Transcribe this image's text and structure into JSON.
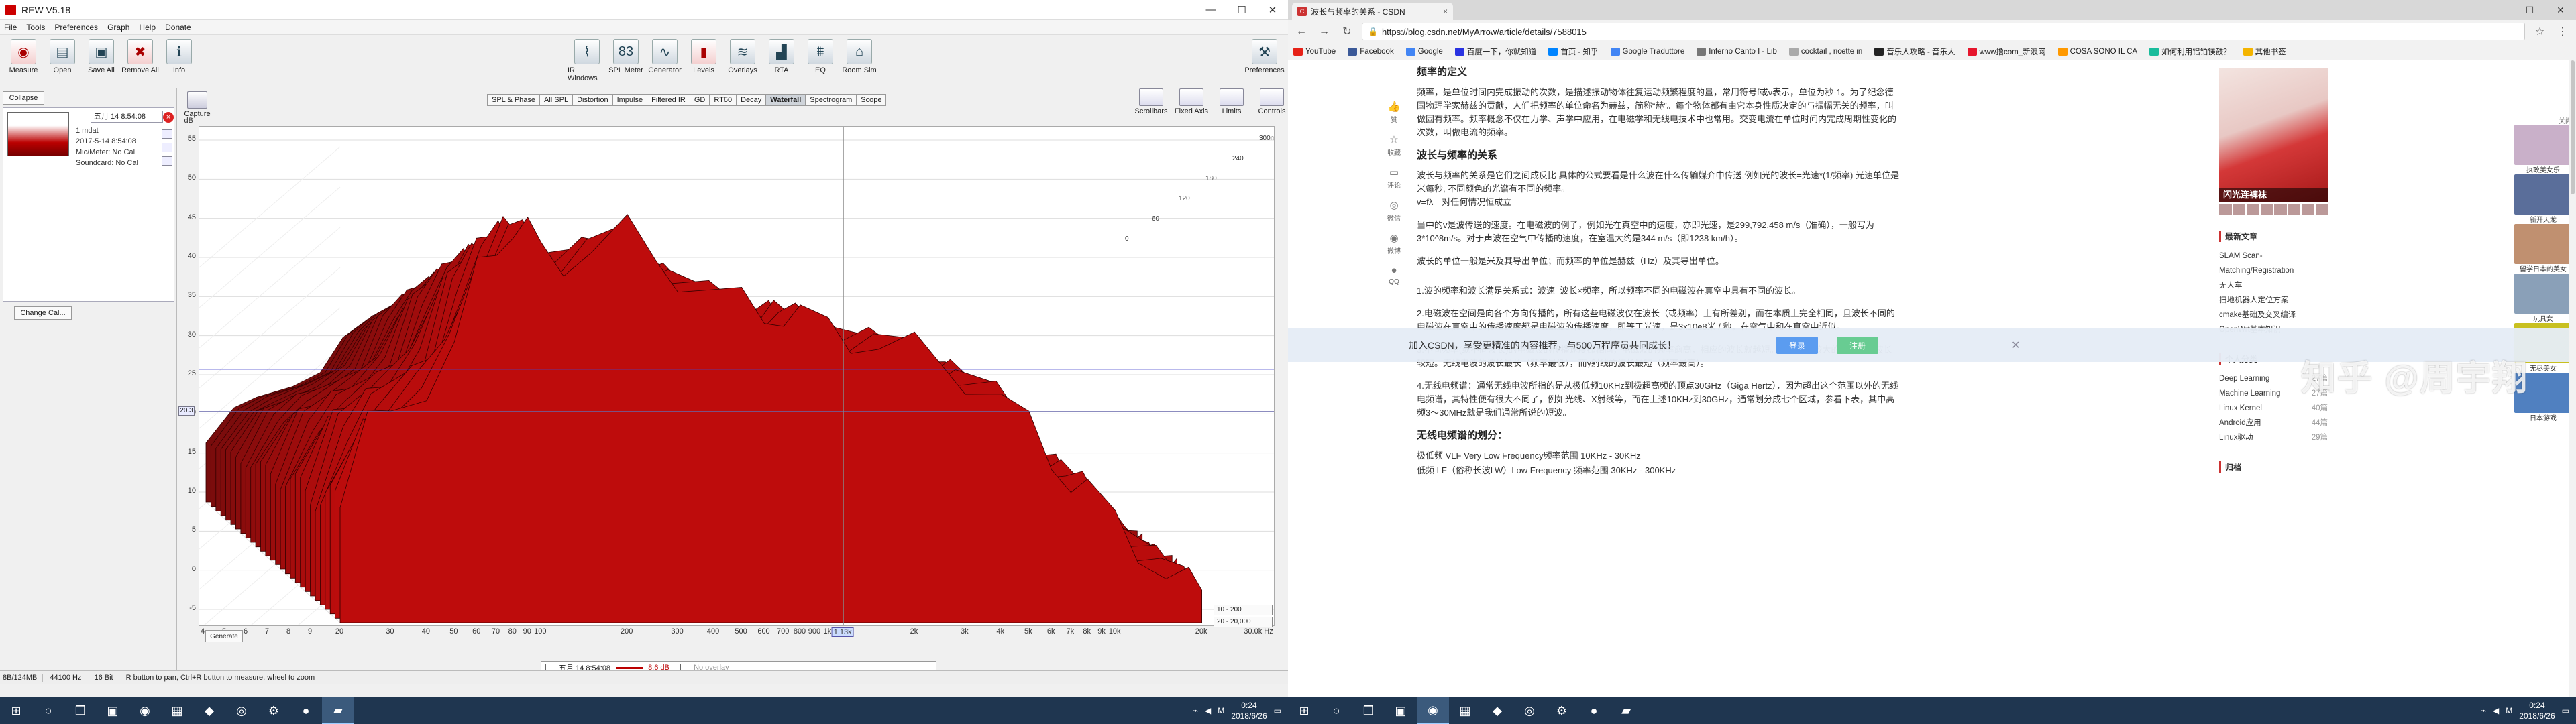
{
  "rew": {
    "title": "REW V5.18",
    "menu": [
      "File",
      "Tools",
      "Preferences",
      "Graph",
      "Help",
      "Donate"
    ],
    "toolbar_left": [
      {
        "label": "Measure",
        "icon": "measure-icon"
      },
      {
        "label": "Open",
        "icon": "folder-open-icon"
      },
      {
        "label": "Save All",
        "icon": "save-icon"
      },
      {
        "label": "Remove All",
        "icon": "remove-icon"
      },
      {
        "label": "Info",
        "icon": "info-icon"
      }
    ],
    "toolbar_right": [
      {
        "label": "IR Windows",
        "icon": "ir-windows-icon"
      },
      {
        "label": "SPL Meter",
        "icon": "spl-meter-icon",
        "badge": "83"
      },
      {
        "label": "Generator",
        "icon": "generator-icon"
      },
      {
        "label": "Levels",
        "icon": "levels-icon"
      },
      {
        "label": "Overlays",
        "icon": "overlays-icon"
      },
      {
        "label": "RTA",
        "icon": "rta-icon"
      },
      {
        "label": "EQ",
        "icon": "eq-icon"
      },
      {
        "label": "Room Sim",
        "icon": "room-sim-icon"
      }
    ],
    "preferences_label": "Preferences",
    "collapse_label": "Collapse",
    "measurement": {
      "name": "五月 14 8:54:08",
      "info": [
        "1 mdat",
        "2017-5-14 8:54:08",
        "Mic/Meter: No Cal",
        "Soundcard: No Cal"
      ]
    },
    "change_cal_label": "Change Cal...",
    "capture_label": "Capture",
    "graph_tabs": [
      "SPL & Phase",
      "All SPL",
      "Distortion",
      "Impulse",
      "Filtered IR",
      "GD",
      "RT60",
      "Decay",
      "Waterfall",
      "Spectrogram",
      "Scope"
    ],
    "active_tab": "Waterfall",
    "graph_controls": [
      "Scrollbars",
      "Fixed Axis",
      "Limits",
      "Controls"
    ],
    "generate_label": "Generate",
    "scale_boxes": [
      "10 - 200",
      "20 - 20,000"
    ],
    "legend": {
      "name": "五月 14 8:54:08",
      "value": "8.6 dB",
      "overlay": "No overlay"
    },
    "status": [
      "8B/124MB",
      "44100 Hz",
      "16 Bit",
      "R button to pan, Ctrl+R button to measure, wheel to zoom"
    ]
  },
  "chart_data": {
    "type": "area",
    "title": "",
    "xlabel": "",
    "ylabel": "dB",
    "x_scale": "log",
    "xlim": [
      20,
      30000
    ],
    "ylim": [
      -5,
      55
    ],
    "y_ticks": [
      55,
      50,
      45,
      40,
      35,
      30,
      25,
      20,
      15,
      10,
      5,
      0,
      -5
    ],
    "y_marker": "20.3",
    "x_ticks": [
      "20",
      "30",
      "40",
      "50",
      "60",
      "70",
      "80",
      "90",
      "100",
      "200",
      "300",
      "400",
      "500",
      "600",
      "700",
      "800",
      "900",
      "1k",
      "1.13k",
      "2k",
      "3k",
      "4k",
      "5k",
      "6k",
      "7k",
      "8k",
      "9k",
      "10k",
      "20k",
      "30.0k Hz"
    ],
    "x_tick_left": [
      "4",
      "5",
      "6",
      "7",
      "8",
      "9"
    ],
    "time_labels": [
      "300ms",
      "240",
      "180",
      "120",
      "60",
      "0"
    ],
    "color": "#b50f0f",
    "horizontal_markers_db": [
      25.7,
      20.3
    ],
    "cursor_freq": 1130,
    "series": [
      {
        "x": [
          20,
          25,
          30,
          40,
          50,
          60,
          70,
          80,
          90,
          100,
          120,
          150,
          200,
          250,
          300,
          400,
          500,
          600,
          700,
          800,
          1000,
          1200,
          1500,
          2000,
          2500,
          3000,
          4000,
          5000,
          6000,
          7000,
          8000,
          10000,
          12000,
          15000,
          18000,
          20000
        ],
        "y": [
          8,
          18,
          21,
          24,
          28,
          38,
          42,
          44,
          43,
          41,
          40,
          41,
          43,
          40,
          38,
          35,
          34,
          33,
          33,
          32,
          31,
          30,
          29,
          28,
          26,
          25,
          22,
          18,
          14,
          12,
          10,
          6,
          3,
          0,
          -2,
          -3
        ]
      }
    ]
  },
  "taskbar": {
    "left_time": "0:24",
    "left_date": "2018/6/26",
    "right_time": "0:24",
    "right_date": "2018/6/26"
  },
  "chrome": {
    "tab_title": "波长与频率的关系 - CSDN",
    "url": "https://blog.csdn.net/MyArrow/article/details/7588015",
    "bookmarks": [
      "YouTube",
      "Facebook",
      "Google",
      "百度一下，你就知道",
      "首页 - 知乎",
      "Google Traduttore",
      "Inferno Canto I - Lib",
      "cocktail , ricette in",
      "音乐人攻略 - 音乐人",
      "www撸com_新浪网",
      "COSA SONO IL CA",
      "如何利用铝铂镁鼓？",
      "其他书签"
    ],
    "share": [
      "赞",
      "收藏",
      "评论",
      "微信",
      "微博",
      "QQ"
    ],
    "article": {
      "h_def": "频率的定义",
      "p_def": "频率，是单位时间内完成振动的次数，是描述振动物体往复运动频繁程度的量，常用符号f或ν表示，单位为秒-1。为了纪念德国物理学家赫兹的贡献，人们把频率的单位命名为赫兹，简称“赫”。每个物体都有由它本身性质决定的与振幅无关的频率，叫做固有频率。频率概念不仅在力学、声学中应用，在电磁学和无线电技术中也常用。交变电流在单位时间内完成周期性变化的次数，叫做电流的频率。",
      "h_rel": "波长与频率的关系",
      "p_rel1": "波长与频率的关系是它们之间成反比 具体的公式要看是什么波在什么传输媒介中传送,例如光的波长=光速*(1/频率) 光速单位是米每秒, 不同颜色的光谱有不同的频率。",
      "p_rel2": "v=fλ　对任何情况恒成立",
      "p_rel3": "当中的v是波传送的速度。在电磁波的例子，例如光在真空中的速度，亦即光速，是299,792,458 m/s（准确），一般写为3*10^8m/s。对于声波在空气中传播的速度，在室温大约是344 m/s（即1238 km/h）。",
      "p_rel4": "波长的单位一般是米及其导出单位；而频率的单位是赫兹（Hz）及其导出单位。",
      "p_n1": "1.波的频率和波长满足关系式：波速=波长×频率，所以频率不同的电磁波在真空中具有不同的波长。",
      "p_n2": "2.电磁波在空间是向各个方向传播的，所有这些电磁波仅在波长（或频率）上有所差别，而在本质上完全相同，且波长不同的电磁波在真空中的传播速度都是电磁波的传播速度，即等于光速，是3x10e8米 / 秒，在空气中和在真空中近似。",
      "p_n3": "3.不同频率(或不同波长)的电磁波的传播速度都相同，电磁波的频率愈高，相应的波长就越短。所以频率较大的电磁波，波长较短。无线电波的波长最长（频率最低），而γ射线的波长最短（频率最高）。",
      "p_n4": "4.无线电频谱：通常无线电波所指的是从极低频10KHz到极超高频的顶点30GHz（Giga Hertz），因为超出这个范围以外的无线电频谱，其特性便有很大不同了，例如光线、X射线等，而在上述10KHz到30GHz，通常划分成七个区域，参看下表，其中高频3～30MHz就是我们通常所说的短波。",
      "h_div": "无线电频谱的划分：",
      "p_vlf": "极低频 VLF Very Low Frequency频率范围 10KHz - 30KHz",
      "p_lf": "低频 LF（俗称长波LW）Low Frequency 频率范围 30KHz - 300KHz"
    },
    "sidebar": {
      "ad_caption": "闪光连裤袜",
      "recent_title": "最新文章",
      "recent": [
        "SLAM Scan-Matching/Registration",
        "无人车",
        "扫地机器人定位方案",
        "cmake基础及交叉编译",
        "OpenWrt基本知识"
      ],
      "cat_title": "个人分类",
      "cats": [
        {
          "name": "Deep Learning",
          "count": "27篇"
        },
        {
          "name": "Machine Learning",
          "count": "27篇"
        },
        {
          "name": "Linux Kernel",
          "count": "40篇"
        },
        {
          "name": "Android应用",
          "count": "44篇"
        },
        {
          "name": "Linux驱动",
          "count": "29篇"
        }
      ],
      "archive_title": "归档"
    },
    "right_ads": {
      "close": "关闭",
      "items": [
        {
          "label": "执政美女乐",
          "color": "#c9b0c9"
        },
        {
          "label": "新开天龙",
          "color": "#5a6e9a"
        },
        {
          "label": "留学日本的美女",
          "color": "#c09070"
        },
        {
          "label": "玩具女",
          "color": "#8aa0b8"
        },
        {
          "label": "无尽美女",
          "color": "#c8c020"
        },
        {
          "label": "日本游戏",
          "color": "#5080c0"
        }
      ]
    },
    "watermark": "知乎 @周宇翔",
    "join": {
      "text": "加入CSDN，享受更精准的内容推荐，与500万程序员共同成长！",
      "login": "登录",
      "register": "注册"
    }
  }
}
